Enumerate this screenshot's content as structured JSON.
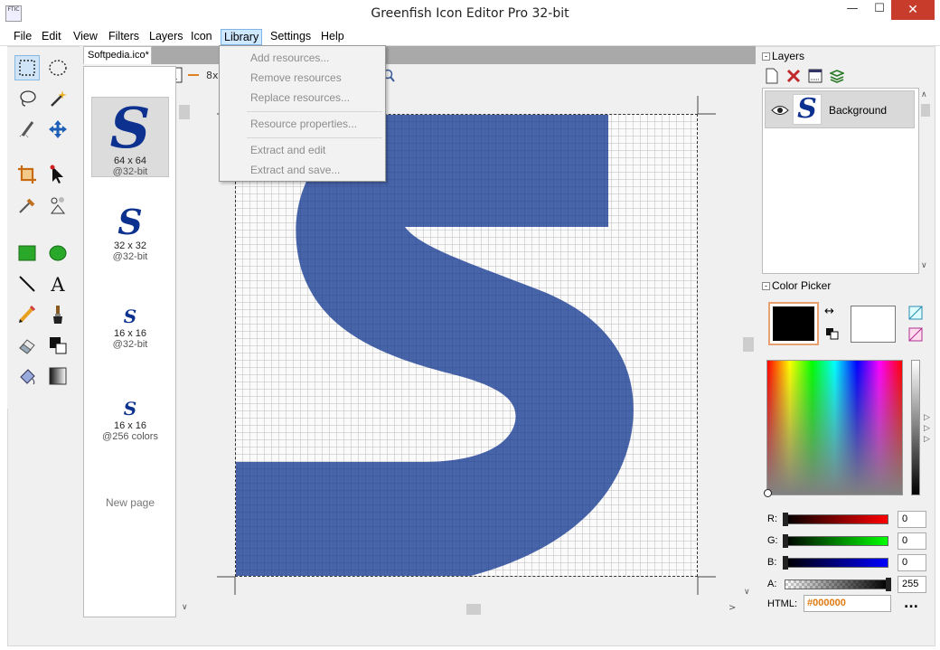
{
  "window": {
    "title": "Greenfish Icon Editor Pro 32-bit",
    "app_icon_text": "FTIC",
    "minimize_glyph": "—",
    "maximize_glyph": "☐",
    "close_glyph": "✕"
  },
  "menubar": [
    "File",
    "Edit",
    "View",
    "Filters",
    "Layers",
    "Icon",
    "Library",
    "Settings",
    "Help"
  ],
  "library_menu": {
    "items": [
      {
        "label": "Add resources...",
        "enabled": false
      },
      {
        "label": "Remove resources",
        "enabled": false
      },
      {
        "label": "Replace resources...",
        "enabled": false
      },
      {
        "label": "Resource properties...",
        "enabled": false
      },
      {
        "label": "Extract and edit",
        "enabled": false
      },
      {
        "label": "Extract and save...",
        "enabled": false
      }
    ]
  },
  "document": {
    "tab_label": "Softpedia.ico*",
    "zoom_label": "8x",
    "pages": [
      {
        "size": "64 x 64",
        "depth": "@32-bit",
        "selected": true
      },
      {
        "size": "32 x 32",
        "depth": "@32-bit",
        "selected": false
      },
      {
        "size": "16 x 16",
        "depth": "@32-bit",
        "selected": false
      },
      {
        "size": "16 x 16",
        "depth": "@256 colors",
        "selected": false
      }
    ],
    "new_page_label": "New page",
    "icon_glyph": "S",
    "icon_color": "#0d318e"
  },
  "layers": {
    "title": "Layers",
    "items": [
      {
        "name": "Background",
        "visible": true
      }
    ]
  },
  "color_picker": {
    "title": "Color Picker",
    "primary": "#000000",
    "secondary": "#ffffff",
    "r_label": "R:",
    "r_value": "0",
    "g_label": "G:",
    "g_value": "0",
    "b_label": "B:",
    "b_value": "0",
    "a_label": "A:",
    "a_value": "255",
    "html_label": "HTML:",
    "html_value": "#000000",
    "more_label": "..."
  }
}
